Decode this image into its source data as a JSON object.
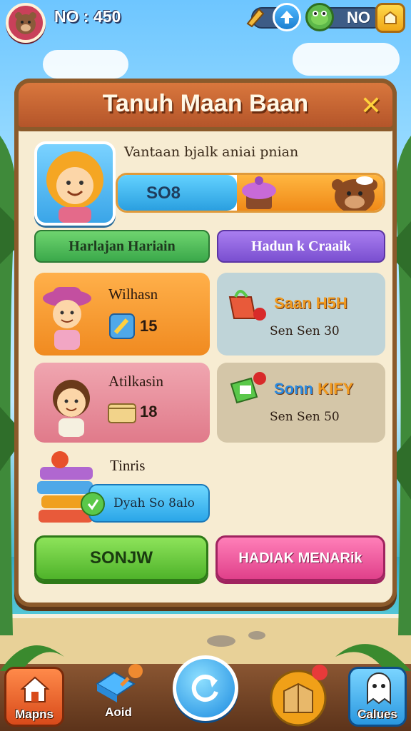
{
  "topbar": {
    "score": "NO : 450",
    "resource_value": "NO"
  },
  "panel": {
    "title": "Tanuh Maan Baan",
    "close_icon": "✕",
    "subtitle": "Vantaan bjalk aniai pnian",
    "progress_value": "SO8",
    "progress_fraction": 0.45
  },
  "tabs": {
    "left": "Harlajan Hariain",
    "right": "Hadun k Craaik"
  },
  "cards": {
    "wilhasn": {
      "title": "Wilhasn",
      "count": "15"
    },
    "atilkasin": {
      "title": "Atilkasin",
      "count": "18"
    },
    "tinris": {
      "title": "Tinris",
      "button": "Dyah So 8alo"
    },
    "shop1": {
      "title": "Saan H5H",
      "price": "Sen Sen 30"
    },
    "shop2": {
      "title": "Sonn KIFY",
      "price": "Sen Sen 50"
    }
  },
  "buttons": {
    "primary": "SONJW",
    "secondary": "HADIAK MENARik"
  },
  "nav": {
    "maps": "Mapns",
    "add": "Aoid",
    "calues": "Calues"
  },
  "colors": {
    "panel_border": "#8b5a2b",
    "header": "#d9773d",
    "accent_green": "#4fb32a",
    "accent_pink": "#e0408a",
    "accent_purple": "#7a4fd0"
  }
}
